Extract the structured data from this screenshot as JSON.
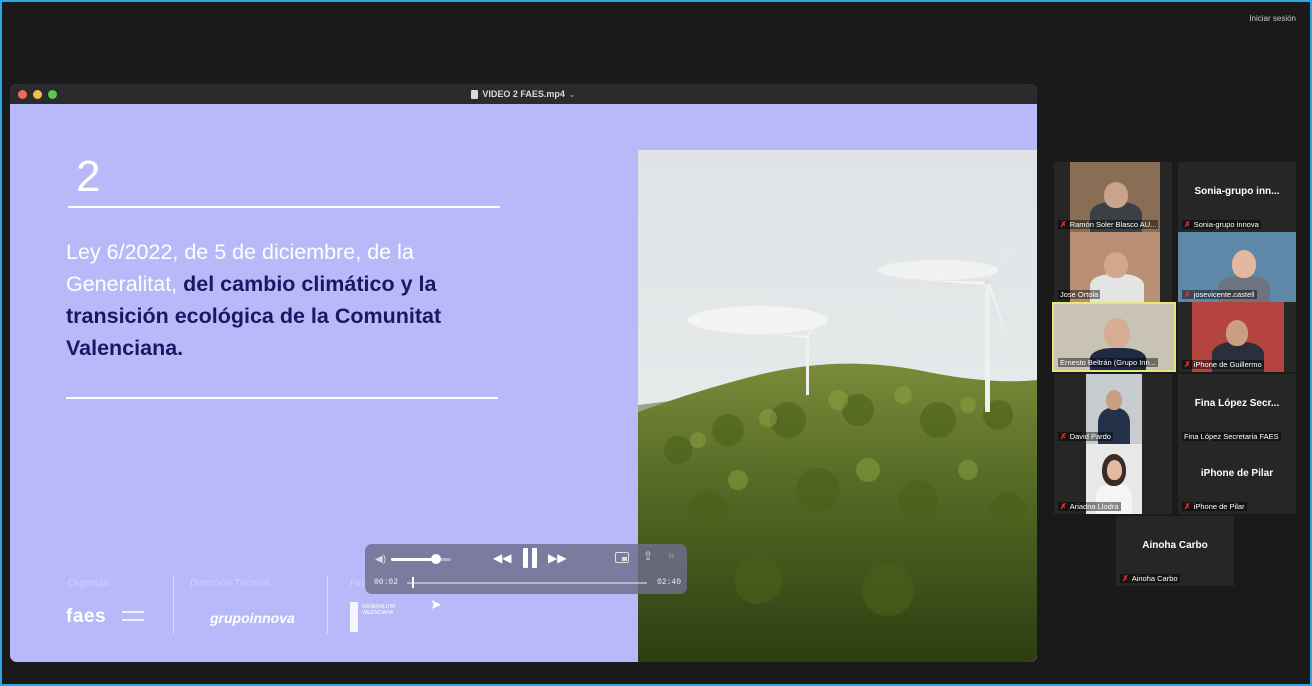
{
  "topbar": {
    "signin_label": "Iniciar sesión"
  },
  "player": {
    "filename": "VIDEO 2 FAES.mp4",
    "slide": {
      "number": "2",
      "text_plain": "Ley 6/2022, de 5 de diciembre, de la Generalitat, ",
      "text_bold": "del cambio climático y la transición ecológica de la Comunitat Valenciana.",
      "footer": {
        "organiza": "Organiza:",
        "direccion": "Dirección Técnica:",
        "financia": "Financia:",
        "logo_faes": "faes",
        "logo_innova": "grupoinnova",
        "logo_gva": "GENERALITAT VALENCIANA"
      }
    },
    "controls": {
      "current_time": "00:02",
      "total_time": "02:40",
      "volume_level": 0.75,
      "progress": 0.02
    }
  },
  "participants": [
    {
      "name": "Ramón Soler Blasco AU...",
      "muted": true,
      "video": true
    },
    {
      "name": "Sonia-grupo innova",
      "big_name": "Sonia-grupo inn...",
      "muted": true,
      "video": false
    },
    {
      "name": "Jose Ortola",
      "muted": false,
      "video": true
    },
    {
      "name": "josevicente.castell",
      "muted": true,
      "video": true
    },
    {
      "name": "Ernesto Beltrán (Grupo Inn...",
      "muted": false,
      "video": true,
      "active": true
    },
    {
      "name": "iPhone de Guillermo",
      "muted": true,
      "video": true
    },
    {
      "name": "David Pardo",
      "muted": true,
      "video": true
    },
    {
      "name": "Fina López Secretaria FAES",
      "big_name": "Fina López Secr...",
      "muted": false,
      "video": false
    },
    {
      "name": "Ariadna Llodra",
      "muted": true,
      "video": true
    },
    {
      "name": "iPhone de Pilar",
      "big_name": "iPhone de Pilar",
      "muted": true,
      "video": false
    },
    {
      "name": "Ainoha Carbo",
      "big_name": "Ainoha Carbo",
      "muted": true,
      "video": false
    }
  ],
  "colors": {
    "slide_bg": "#b8b9f8",
    "slide_bold": "#1e1664",
    "frame": "#2aa7e4",
    "active_speaker": "#e6e67a"
  }
}
